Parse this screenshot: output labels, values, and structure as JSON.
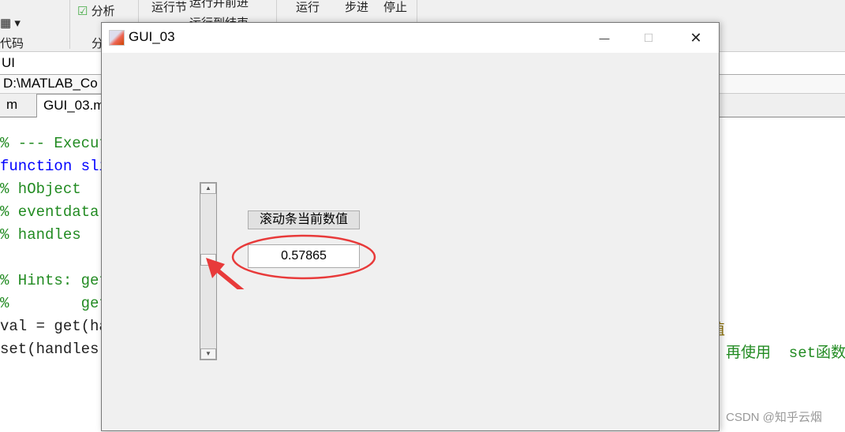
{
  "toolbar": {
    "analyze": "分析",
    "run_section": "运行节",
    "run_advance": "运行并前进",
    "run_to_end": "运行到结束",
    "run": "运行",
    "step": "步进",
    "stop": "停止",
    "code_group": "代码",
    "analyze_group": "分"
  },
  "editor": {
    "title_fragment": "UI",
    "path_fragment": "D:\\MATLAB_Co",
    "tabs": [
      {
        "label": "m"
      },
      {
        "label": "GUI_03.m"
      }
    ],
    "code_lines": [
      {
        "text": "% --- Execut",
        "kind": "cm"
      },
      {
        "text": "function sli",
        "kind": "kw"
      },
      {
        "text": "% hObject",
        "kind": "cm"
      },
      {
        "text": "% eventdata",
        "kind": "cm"
      },
      {
        "text": "% handles",
        "kind": "cm"
      },
      {
        "text": "",
        "kind": "tx"
      },
      {
        "text": "% Hints: get",
        "kind": "cm"
      },
      {
        "text": "%        get",
        "kind": "cm"
      },
      {
        "text": "val = get(ha",
        "kind": "tx"
      },
      {
        "text": "set(handles.",
        "kind": "tx"
      }
    ],
    "right_fragment_1": "值",
    "right_fragment_2": "再使用  set函数"
  },
  "figure": {
    "title": "GUI_03",
    "minimize": "—",
    "maximize": "☐",
    "close": "✕",
    "slider": {
      "value": 0.57865,
      "min": 0,
      "max": 1,
      "orientation": "vertical"
    },
    "label": "滚动条当前数值",
    "value_text": "0.57865"
  },
  "annotation_color": "#e83a3a",
  "watermark": "CSDN @知乎云烟"
}
